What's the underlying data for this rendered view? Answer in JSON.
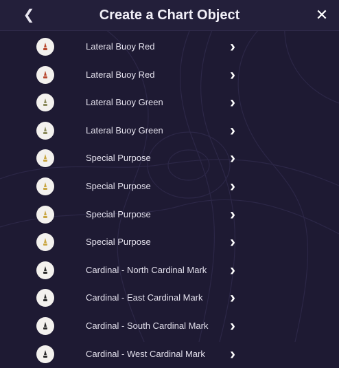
{
  "header": {
    "title": "Create a Chart Object",
    "back_icon": "chevron-left-icon",
    "close_icon": "close-icon"
  },
  "colors": {
    "background": "#1e1a33",
    "badge": "#f3f1ee",
    "red": "#b8472e",
    "green": "#8a8a5c",
    "yellow": "#c9a642",
    "black": "#2a2a2a"
  },
  "items": [
    {
      "label": "Lateral Buoy Red",
      "icon": "lateral-buoy-red-icon",
      "color": "#b8472e"
    },
    {
      "label": "Lateral Buoy Red",
      "icon": "lateral-buoy-red-icon",
      "color": "#b8472e"
    },
    {
      "label": "Lateral Buoy Green",
      "icon": "lateral-buoy-green-icon",
      "color": "#8a8a5c"
    },
    {
      "label": "Lateral Buoy Green",
      "icon": "lateral-buoy-green-icon",
      "color": "#8a8a5c"
    },
    {
      "label": "Special Purpose",
      "icon": "special-purpose-icon",
      "color": "#c9a642"
    },
    {
      "label": "Special Purpose",
      "icon": "special-purpose-icon",
      "color": "#c9a642"
    },
    {
      "label": "Special Purpose",
      "icon": "special-purpose-icon",
      "color": "#c9a642"
    },
    {
      "label": "Special Purpose",
      "icon": "special-purpose-icon",
      "color": "#c9a642"
    },
    {
      "label": "Cardinal - North Cardinal Mark",
      "icon": "cardinal-north-icon",
      "color": "#2a2a2a"
    },
    {
      "label": "Cardinal - East Cardinal Mark",
      "icon": "cardinal-east-icon",
      "color": "#2a2a2a"
    },
    {
      "label": "Cardinal - South Cardinal Mark",
      "icon": "cardinal-south-icon",
      "color": "#2a2a2a"
    },
    {
      "label": "Cardinal - West Cardinal Mark",
      "icon": "cardinal-west-icon",
      "color": "#2a2a2a"
    }
  ]
}
